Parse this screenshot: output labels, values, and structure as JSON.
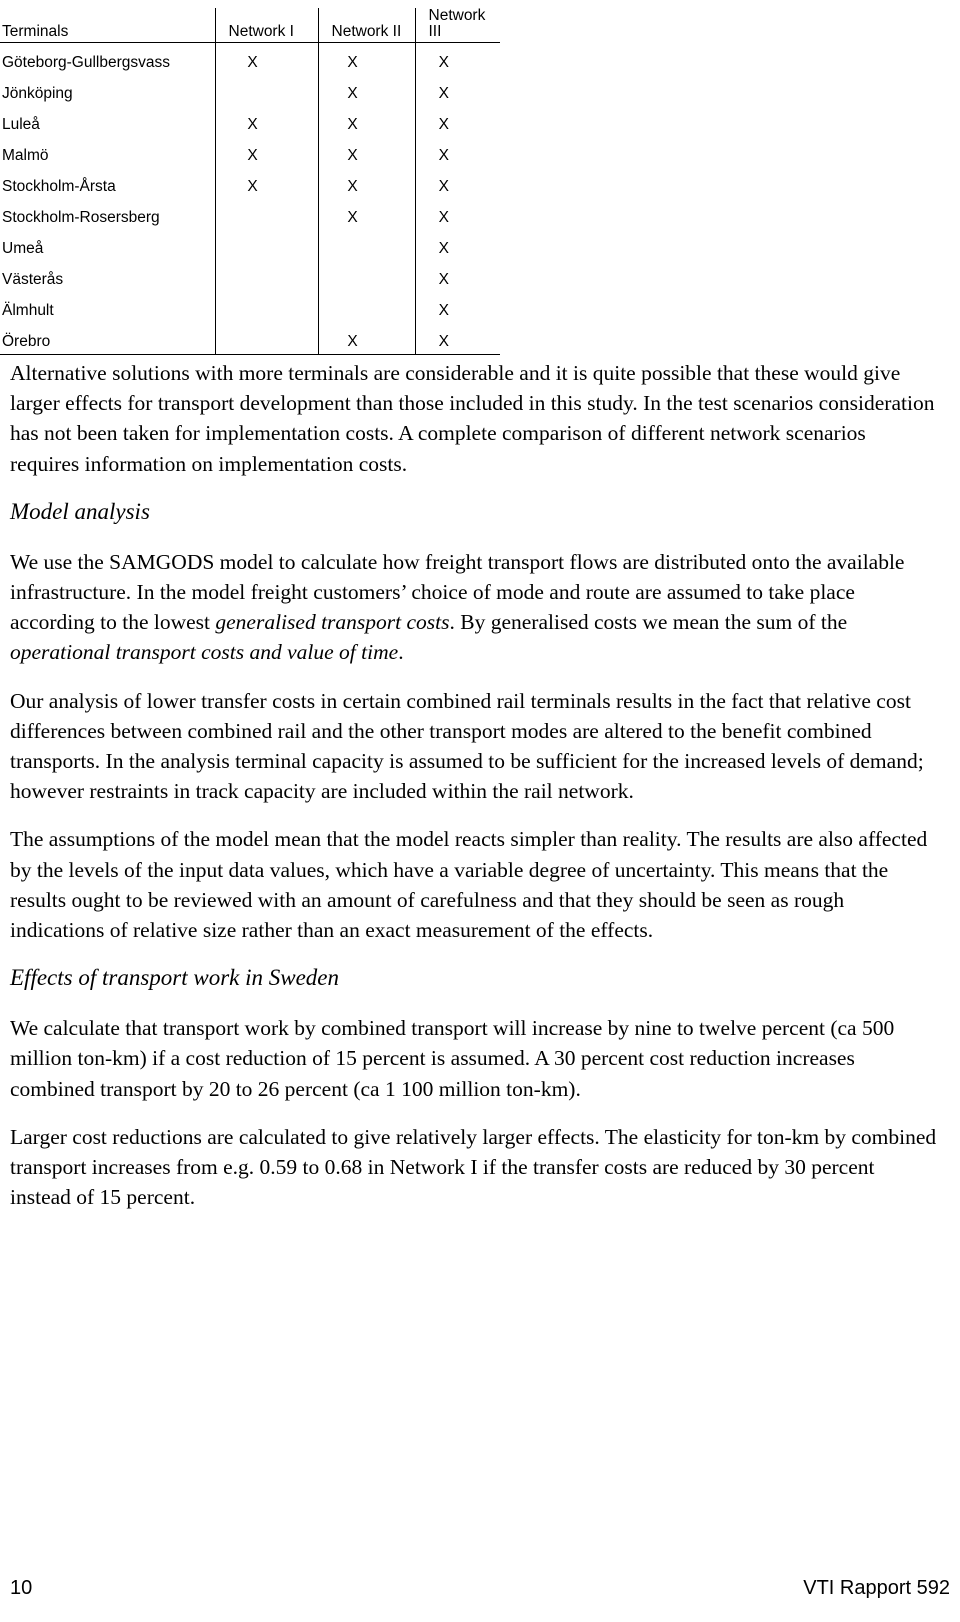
{
  "table": {
    "columns": [
      "Terminals",
      "Network  I",
      "Network  II",
      "Network  III"
    ],
    "mark": "X",
    "rows": [
      {
        "terminal": "Göteborg-Gullbergsvass",
        "n1": "X",
        "n2": "X",
        "n3": "X"
      },
      {
        "terminal": "Jönköping",
        "n1": "",
        "n2": "X",
        "n3": "X"
      },
      {
        "terminal": "Luleå",
        "n1": "X",
        "n2": "X",
        "n3": "X"
      },
      {
        "terminal": "Malmö",
        "n1": "X",
        "n2": "X",
        "n3": "X"
      },
      {
        "terminal": "Stockholm-Årsta",
        "n1": "X",
        "n2": "X",
        "n3": "X"
      },
      {
        "terminal": "Stockholm-Rosersberg",
        "n1": "",
        "n2": "X",
        "n3": "X"
      },
      {
        "terminal": "Umeå",
        "n1": "",
        "n2": "",
        "n3": "X"
      },
      {
        "terminal": "Västerås",
        "n1": "",
        "n2": "",
        "n3": "X"
      },
      {
        "terminal": "Älmhult",
        "n1": "",
        "n2": "",
        "n3": "X"
      },
      {
        "terminal": "Örebro",
        "n1": "",
        "n2": "X",
        "n3": "X"
      }
    ]
  },
  "body": {
    "para_terminals": "Alternative solutions with more terminals are considerable and it is quite possible that these would give larger effects for transport development than those included in this study. In the test scenarios consideration has not been taken for implementation costs. A complete comparison of different network scenarios requires information on implementation costs.",
    "heading_model_analysis": "Model analysis",
    "para_model_1a": "We use the SAMGODS model to calculate how freight transport flows are distributed onto the available infrastructure. In the model freight customers’ choice of mode and route are assumed to take place according to the lowest ",
    "para_model_1_em1": "generalised transport costs",
    "para_model_1b": ". By generalised costs we mean the sum of the ",
    "para_model_1_em2": "operational transport costs and value of time",
    "para_model_1c": ".",
    "para_model_2": "Our analysis of lower transfer costs in certain combined rail terminals results in the fact that relative cost differences between combined rail and the other transport modes are altered to the benefit combined transports. In the analysis terminal capacity is assumed to be sufficient for the increased levels of demand; however restraints in track capacity are included within the rail network.",
    "para_model_3": "The assumptions of the model mean that the model reacts simpler than reality. The results are also affected by the levels of the input data values, which have a variable degree of uncertainty. This means that the results ought to be reviewed with an amount of carefulness and that they should be seen as rough indications of relative size rather than an exact measurement of the effects.",
    "heading_effects": "Effects of transport work in Sweden",
    "para_effects_1": "We calculate that transport work by combined transport will increase by nine to twelve percent (ca 500 million ton-km) if a cost reduction of 15 percent is assumed. A 30 percent cost reduction increases combined transport by 20 to 26 percent (ca 1 100 million ton-km).",
    "para_effects_2": "Larger cost reductions are calculated to give relatively larger effects. The elasticity for ton-km by combined transport increases from e.g. 0.59 to 0.68 in Network I if the transfer costs are reduced by 30 percent instead of 15 percent."
  },
  "footer": {
    "page_number": "10",
    "report": "VTI Rapport 592"
  }
}
